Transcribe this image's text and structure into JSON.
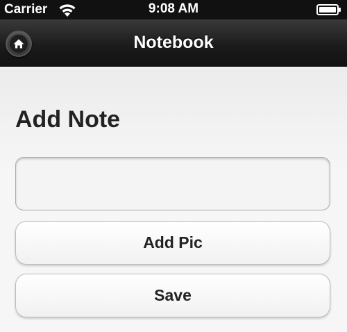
{
  "status_bar": {
    "carrier": "Carrier",
    "time": "9:08 AM",
    "wifi_icon": "wifi-icon",
    "battery_icon": "battery-icon"
  },
  "header": {
    "title": "Notebook",
    "home_icon": "home-icon"
  },
  "form": {
    "heading": "Add Note",
    "note_value": "",
    "add_pic_label": "Add Pic",
    "save_label": "Save"
  }
}
